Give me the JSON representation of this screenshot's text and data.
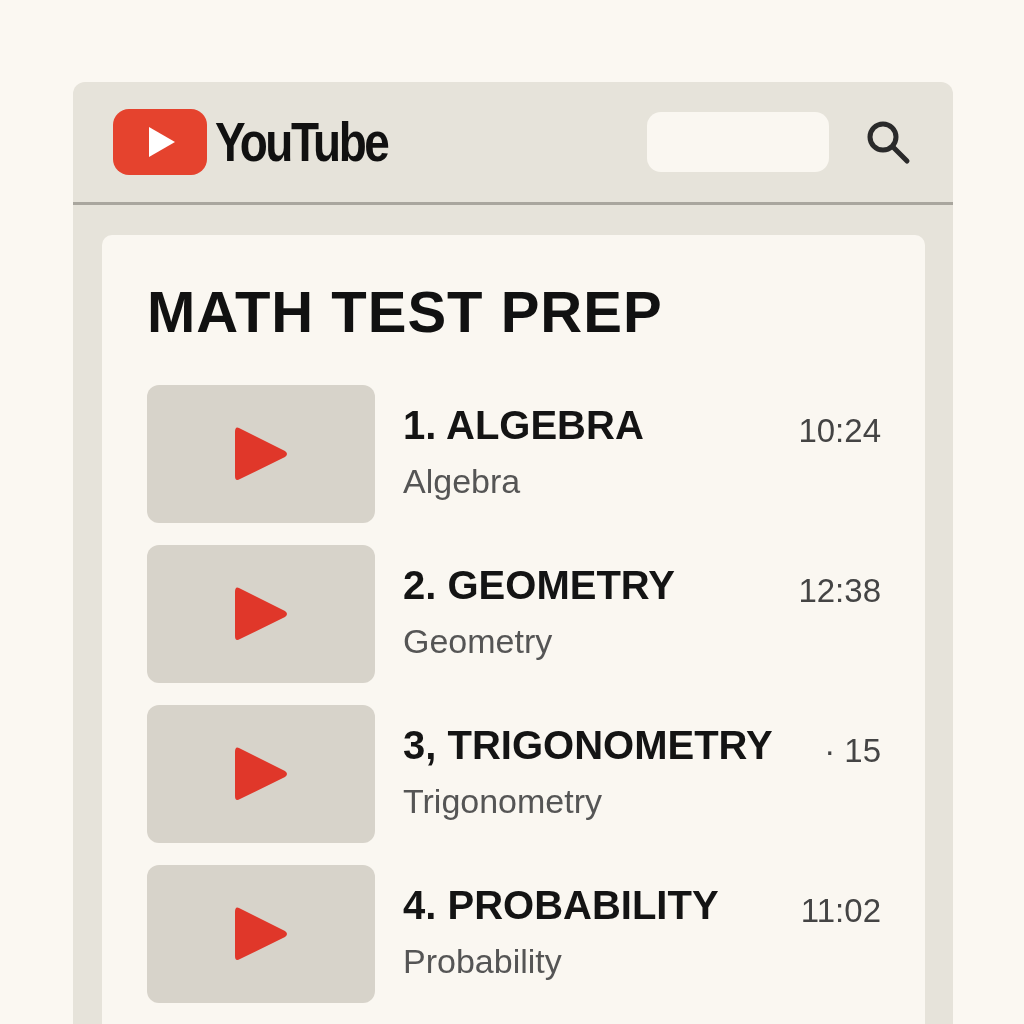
{
  "header": {
    "logo_text": "YouTube"
  },
  "playlist": {
    "title": "MATH TEST PREP",
    "videos": [
      {
        "title": "1. ALGEBRA",
        "subtitle": "Algebra",
        "duration": "10:24"
      },
      {
        "title": "2. GEOMETRY",
        "subtitle": "Geometry",
        "duration": "12:38"
      },
      {
        "title": "3, TRIGONOMETRY",
        "subtitle": "Trigonometry",
        "duration": "· 15"
      },
      {
        "title": "4. PROBABILITY",
        "subtitle": "Probability",
        "duration": "11:02"
      }
    ]
  }
}
